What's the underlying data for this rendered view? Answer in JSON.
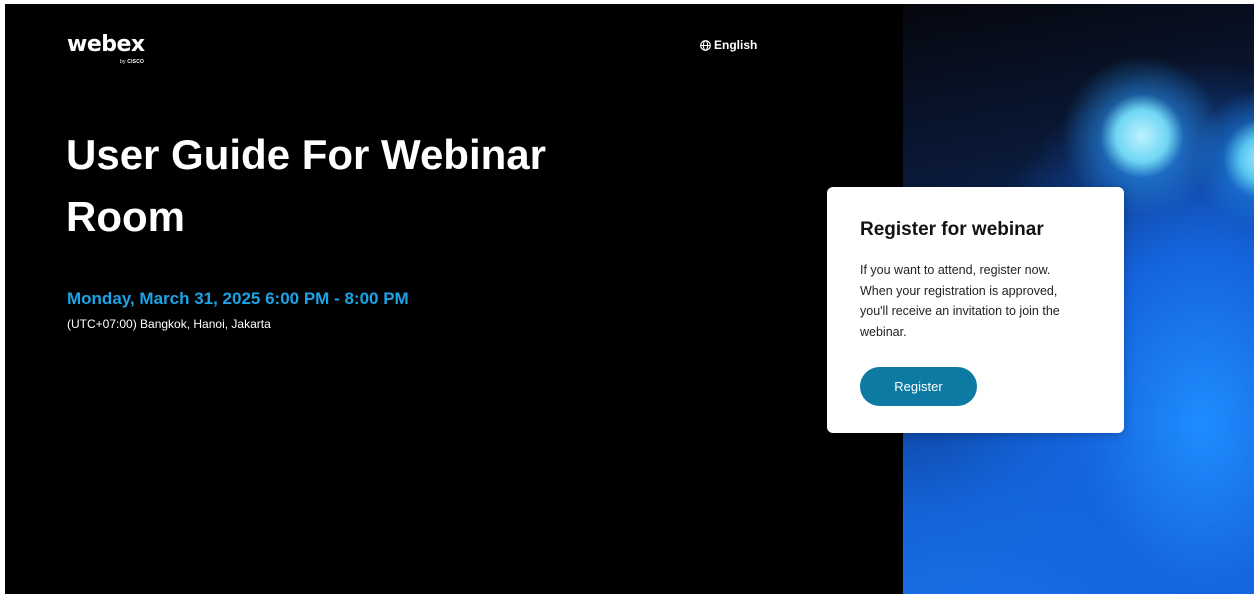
{
  "brand": {
    "logo_text": "webex",
    "logo_by": "by",
    "logo_company": "CISCO"
  },
  "header": {
    "language_label": "English",
    "language_icon": "globe-icon"
  },
  "event": {
    "title_line1": "User Guide For Webinar",
    "title_line2": "Room",
    "datetime": "Monday, March 31, 2025 6:00 PM - 8:00 PM",
    "timezone": "(UTC+07:00) Bangkok, Hanoi, Jakarta"
  },
  "register_card": {
    "title": "Register for webinar",
    "text_lines": [
      "If you want to attend, register now.",
      "When your registration is approved,",
      "you'll receive an invitation to join the",
      "webinar."
    ],
    "button_label": "Register"
  },
  "colors": {
    "background": "#000000",
    "date_accent": "#1ca3e6",
    "button": "#0d7aa3",
    "card": "#ffffff"
  }
}
